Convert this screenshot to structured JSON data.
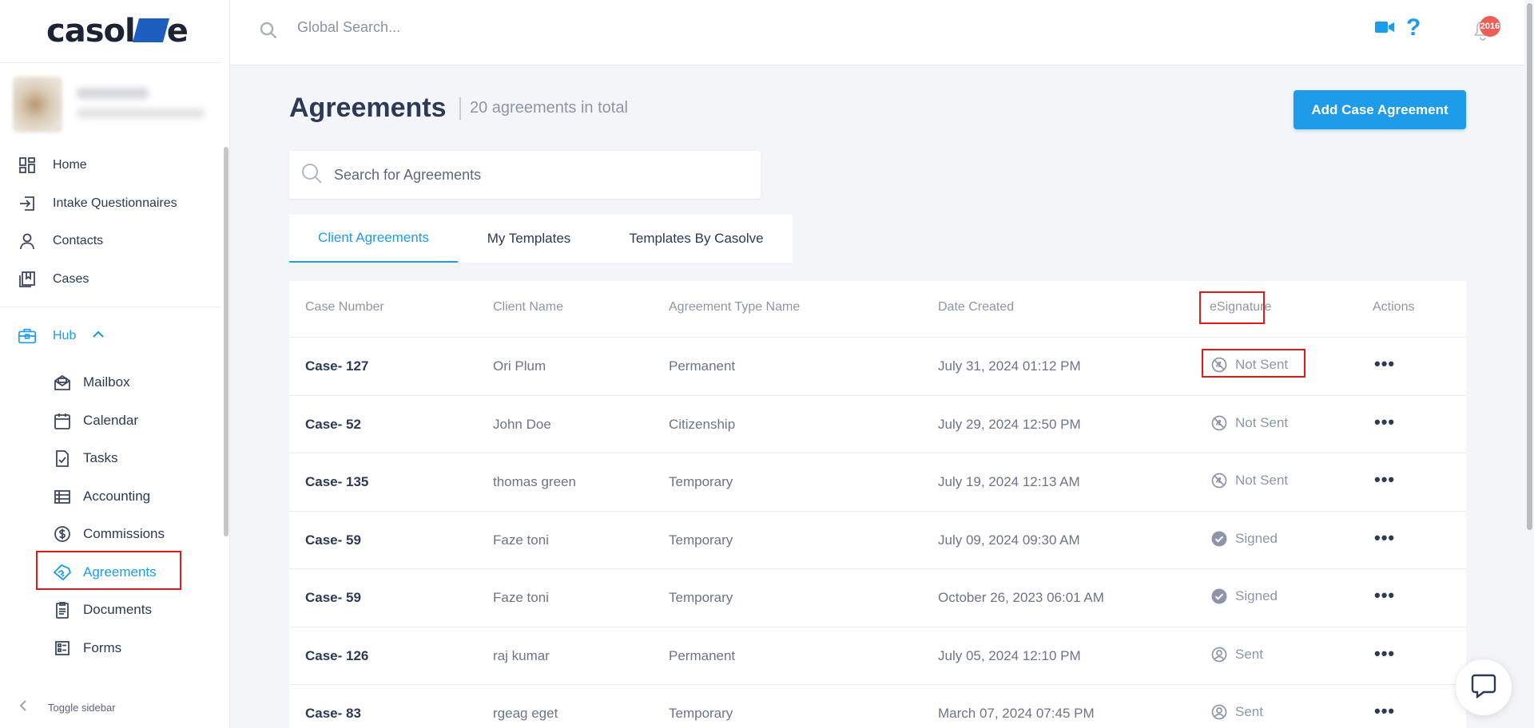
{
  "app": {
    "logo_text_left": "casol",
    "logo_text_right": "e"
  },
  "topbar": {
    "search_placeholder": "Global Search...",
    "notification_count": "2016"
  },
  "sidebar": {
    "main_items": [
      {
        "label": "Home",
        "icon": "dashboard-icon"
      },
      {
        "label": "Intake Questionnaires",
        "icon": "sign-in-icon"
      },
      {
        "label": "Contacts",
        "icon": "person-icon"
      },
      {
        "label": "Cases",
        "icon": "bookmarks-icon"
      }
    ],
    "hub_label": "Hub",
    "hub_items": [
      {
        "label": "Mailbox",
        "icon": "mailbox-icon"
      },
      {
        "label": "Calendar",
        "icon": "calendar-icon"
      },
      {
        "label": "Tasks",
        "icon": "task-file-icon"
      },
      {
        "label": "Accounting",
        "icon": "ledger-icon"
      },
      {
        "label": "Commissions",
        "icon": "dollar-circle-icon"
      },
      {
        "label": "Agreements",
        "icon": "handshake-icon"
      },
      {
        "label": "Documents",
        "icon": "clipboard-icon"
      },
      {
        "label": "Forms",
        "icon": "form-icon"
      }
    ],
    "toggle_label": "Toggle sidebar"
  },
  "page": {
    "title": "Agreements",
    "subtitle": "20 agreements in total",
    "add_button": "Add Case Agreement",
    "search_placeholder": "Search for Agreements",
    "tabs": [
      "Client Agreements",
      "My Templates",
      "Templates By Casolve"
    ]
  },
  "table": {
    "headers": [
      "Case Number",
      "Client Name",
      "Agreement Type Name",
      "Date Created",
      "eSignature",
      "Actions"
    ],
    "rows": [
      {
        "case": "Case- 127",
        "client": "Ori Plum",
        "type": "Permanent",
        "date": "July 31, 2024 01:12 PM",
        "esign": "Not Sent"
      },
      {
        "case": "Case- 52",
        "client": "John Doe",
        "type": "Citizenship",
        "date": "July 29, 2024 12:50 PM",
        "esign": "Not Sent"
      },
      {
        "case": "Case- 135",
        "client": "thomas green",
        "type": "Temporary",
        "date": "July 19, 2024 12:13 AM",
        "esign": "Not Sent"
      },
      {
        "case": "Case- 59",
        "client": "Faze toni",
        "type": "Temporary",
        "date": "July 09, 2024 09:30 AM",
        "esign": "Signed"
      },
      {
        "case": "Case- 59",
        "client": "Faze toni",
        "type": "Temporary",
        "date": "October 26, 2023 06:01 AM",
        "esign": "Signed"
      },
      {
        "case": "Case- 126",
        "client": "raj kumar",
        "type": "Permanent",
        "date": "July 05, 2024 12:10 PM",
        "esign": "Sent"
      },
      {
        "case": "Case- 83",
        "client": "rgeag eget",
        "type": "Temporary",
        "date": "March 07, 2024 07:45 PM",
        "esign": "Sent"
      }
    ],
    "actions_glyph": "•••"
  },
  "colors": {
    "accent": "#1e9be9",
    "highlight_box": "#e8151b",
    "text_dark": "#2b3a55",
    "text_muted": "#8d96a8"
  }
}
